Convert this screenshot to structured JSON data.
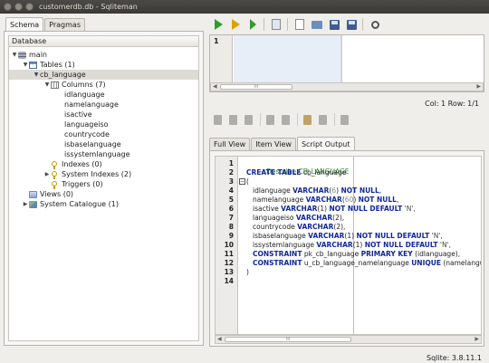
{
  "window": {
    "title": "customerdb.db - Sqliteman"
  },
  "left_tabs": [
    {
      "label": "Schema"
    },
    {
      "label": "Pragmas"
    }
  ],
  "tree_header": "Database",
  "tree": [
    {
      "label": "main",
      "icon": "database-icon"
    },
    {
      "label": "Tables (1)",
      "icon": "table-icon"
    },
    {
      "label": "cb_language"
    },
    {
      "label": "Columns (7)",
      "icon": "columns-icon"
    },
    {
      "label": "idlanguage"
    },
    {
      "label": "namelanguage"
    },
    {
      "label": "isactive"
    },
    {
      "label": "languageiso"
    },
    {
      "label": "countrycode"
    },
    {
      "label": "isbaselanguage"
    },
    {
      "label": "issystemlanguage"
    },
    {
      "label": "Indexes (0)",
      "icon": "key-icon"
    },
    {
      "label": "System Indexes (2)",
      "icon": "key-icon"
    },
    {
      "label": "Triggers (0)",
      "icon": "key-icon"
    },
    {
      "label": "Views (0)",
      "icon": "views-icon"
    },
    {
      "label": "System Catalogue (1)",
      "icon": "catalogue-icon"
    }
  ],
  "grid": {
    "row_number": "1",
    "scroll_label": "III"
  },
  "position": "Col: 1 Row: 1/1",
  "right_tabs": [
    {
      "label": "Full View"
    },
    {
      "label": "Item View"
    },
    {
      "label": "Script Output"
    }
  ],
  "editor_line_numbers": [
    "1",
    "2",
    "3",
    "4",
    "5",
    "6",
    "7",
    "8",
    "9",
    "10",
    "11",
    "12",
    "13",
    "14"
  ],
  "script": {
    "l1": "-- Describe CB_LANGUAGE",
    "l2a": "CREATE TABLE",
    "l2b": " cb_language",
    "l3": "(",
    "l4a": "idlanguage ",
    "l4b": "VARCHAR",
    "l4c": "(",
    "l4d": "6",
    "l4e": ") ",
    "l4f": "NOT NULL",
    "l4g": ",",
    "l5a": "namelanguage ",
    "l5b": "VARCHAR",
    "l5c": "(",
    "l5d": "60",
    "l5e": ") ",
    "l5f": "NOT NULL",
    "l5g": ",",
    "l6a": "isactive ",
    "l6b": "VARCHAR",
    "l6c": "(1) ",
    "l6d": "NOT NULL DEFAULT",
    "l6e": " 'N',",
    "l7a": "languageiso ",
    "l7b": "VARCHAR",
    "l7c": "(2),",
    "l8a": "countrycode ",
    "l8b": "VARCHAR",
    "l8c": "(2),",
    "l9a": "isbaselanguage ",
    "l9b": "VARCHAR",
    "l9c": "(1) ",
    "l9d": "NOT NULL DEFAULT",
    "l9e": " 'N',",
    "l10a": "issystemlanguage ",
    "l10b": "VARCHAR",
    "l10c": "(1) ",
    "l10d": "NOT NULL DEFAULT",
    "l10e": " 'N',",
    "l11a": "CONSTRAINT",
    "l11b": " pk_cb_language ",
    "l11c": "PRIMARY KEY",
    "l11d": " (idlanguage),",
    "l12a": "CONSTRAINT",
    "l12b": " u_cb_language_namelanguage ",
    "l12c": "UNIQUE",
    "l12d": " (namelangu",
    "l13": ")"
  },
  "editor_scroll_label": "III",
  "version": "Sqlite: 3.8.11.1",
  "colors": {
    "keyword": "#10279e",
    "comment": "#2f8f2f",
    "run": "#2e9e2e"
  }
}
